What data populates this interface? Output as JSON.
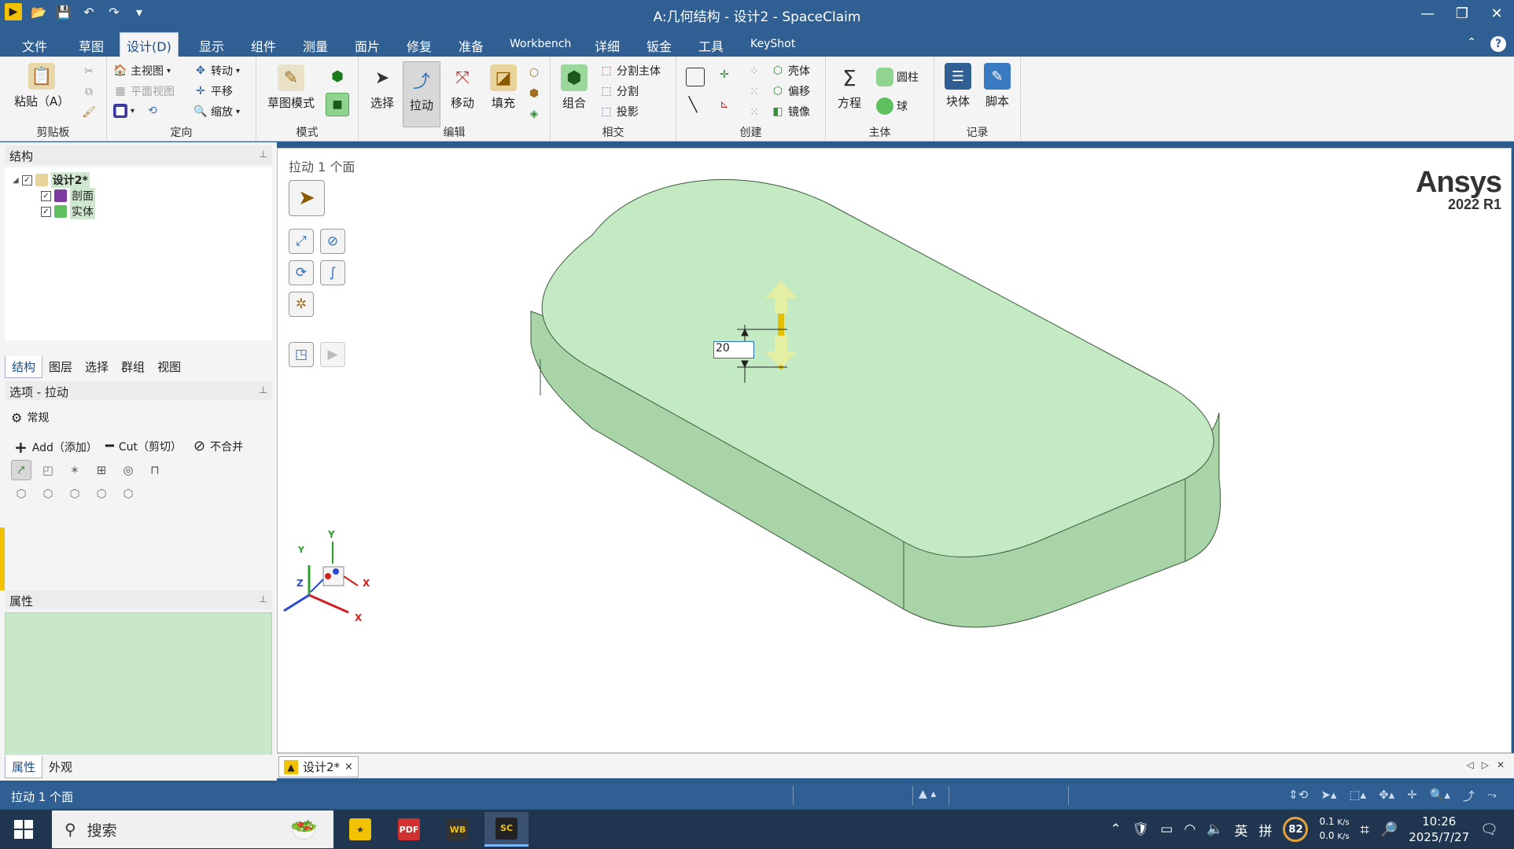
{
  "window": {
    "title": "A:几何结构 - 设计2 - SpaceClaim"
  },
  "quick_access": {
    "icons": [
      "app-logo",
      "open-icon",
      "save-icon",
      "undo-icon",
      "redo-icon",
      "customize-icon"
    ]
  },
  "menu": {
    "tabs": [
      "文件",
      "草图",
      "设计(D)",
      "显示",
      "组件",
      "测量",
      "面片",
      "修复",
      "准备",
      "Workbench",
      "详细",
      "钣金",
      "工具",
      "KeyShot"
    ],
    "active": "设计(D)"
  },
  "ribbon": {
    "clipboard": {
      "label": "剪贴板",
      "paste": "粘贴（A）"
    },
    "orient": {
      "label": "定向",
      "home": "主视图",
      "plan": "平面视图",
      "spin": "转动",
      "pan": "平移",
      "zoom": "缩放"
    },
    "mode": {
      "label": "模式",
      "sketch": "草图模式"
    },
    "edit": {
      "label": "编辑",
      "select": "选择",
      "pull": "拉动",
      "move": "移动",
      "fill": "填充"
    },
    "intersect": {
      "label": "相交",
      "combine": "组合",
      "split_body": "分割主体",
      "split": "分割",
      "project": "投影"
    },
    "create": {
      "label": "创建",
      "shell": "壳体",
      "offset": "偏移",
      "mirror": "镜像"
    },
    "body": {
      "label": "主体",
      "equation": "方程",
      "cylinder": "圆柱",
      "sphere": "球"
    },
    "record": {
      "label": "记录",
      "block": "块体",
      "script": "脚本"
    }
  },
  "structure": {
    "title": "结构",
    "tree": [
      {
        "label": "设计2*",
        "checked": "✓"
      },
      {
        "label": "剖面",
        "checked": "✓"
      },
      {
        "label": "实体",
        "checked": "✓"
      }
    ],
    "tabs": [
      "结构",
      "图层",
      "选择",
      "群组",
      "视图"
    ]
  },
  "options": {
    "title": "选项 - 拉动",
    "general": "常规",
    "add": "Add（添加）",
    "cut": "Cut（剪切）",
    "nomerge": "不合并"
  },
  "properties": {
    "title": "属性",
    "tabs": [
      "属性",
      "外观"
    ]
  },
  "viewport": {
    "status_caption": "拉动 1 个面",
    "brand": "Ansys",
    "version": "2022 R1",
    "dimension_value": "20",
    "triad": {
      "x": "X",
      "y": "Y",
      "z": "Z"
    }
  },
  "doc_tab": {
    "label": "设计2*",
    "close": "×"
  },
  "statusbar": {
    "text": "拉动 1 个面"
  },
  "taskbar": {
    "search": "搜索",
    "ime": "英",
    "ime2": "拼",
    "cpu": "82",
    "net_up": "0.1",
    "net_down": "0.0",
    "net_unit": "K/s",
    "time": "10:26",
    "date": "2025/7/27"
  },
  "colors": {
    "accent": "#2f5f93",
    "model_face": "#c4eac4",
    "model_side": "#a8d4a8",
    "edge": "#3a5a3a"
  }
}
